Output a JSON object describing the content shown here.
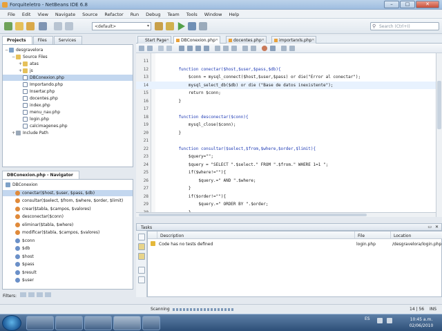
{
  "window": {
    "title": "Forquiteletro - NetBeans IDE 6.8"
  },
  "menus": [
    "File",
    "Edit",
    "View",
    "Navigate",
    "Source",
    "Refactor",
    "Run",
    "Debug",
    "Team",
    "Tools",
    "Window",
    "Help"
  ],
  "toolbar": {
    "config_value": "<default>",
    "search_placeholder": "Search (Ctrl+I)"
  },
  "project_panel": {
    "tabs": [
      "Projects",
      "Files",
      "Services"
    ],
    "items": [
      {
        "label": "desgravelora",
        "depth": 0,
        "icon": "project-icon",
        "exp": "−"
      },
      {
        "label": "Source Files",
        "depth": 1,
        "icon": "folder-icon",
        "exp": "−"
      },
      {
        "label": "atas",
        "depth": 2,
        "icon": "folder-icon",
        "exp": "+"
      },
      {
        "label": "js",
        "depth": 2,
        "icon": "folder-icon",
        "exp": "+"
      },
      {
        "label": "DBConexion.php",
        "depth": 2,
        "icon": "php-file-icon",
        "exp": "",
        "selected": true
      },
      {
        "label": "Importando.php",
        "depth": 2,
        "icon": "php-file-icon",
        "exp": ""
      },
      {
        "label": "Insertar.php",
        "depth": 2,
        "icon": "php-file-icon",
        "exp": ""
      },
      {
        "label": "docentes.php",
        "depth": 2,
        "icon": "php-file-icon",
        "exp": ""
      },
      {
        "label": "index.php",
        "depth": 2,
        "icon": "php-file-icon",
        "exp": ""
      },
      {
        "label": "menu_nav.php",
        "depth": 2,
        "icon": "php-file-icon",
        "exp": ""
      },
      {
        "label": "login.php",
        "depth": 2,
        "icon": "php-file-icon",
        "exp": ""
      },
      {
        "label": "calcimagenes.php",
        "depth": 2,
        "icon": "php-file-icon",
        "exp": ""
      },
      {
        "label": "Include Path",
        "depth": 1,
        "icon": "library-icon",
        "exp": "+"
      }
    ]
  },
  "navigator_panel": {
    "title": "DBConexion.php - Navigator",
    "items": [
      {
        "label": "DBConexion",
        "kind": "class"
      },
      {
        "label": "conectar($host, $user, $pass, $db)",
        "kind": "method",
        "selected": true
      },
      {
        "label": "consultar($select, $from, $where, $order, $limit)",
        "kind": "method"
      },
      {
        "label": "crear($tabla, $campos, $valores)",
        "kind": "method"
      },
      {
        "label": "desconectar($conn)",
        "kind": "method"
      },
      {
        "label": "eliminar($tabla, $where)",
        "kind": "method"
      },
      {
        "label": "modificar($tabla, $campos, $valores)",
        "kind": "method"
      },
      {
        "label": "$conn",
        "kind": "var"
      },
      {
        "label": "$db",
        "kind": "var"
      },
      {
        "label": "$host",
        "kind": "var"
      },
      {
        "label": "$pass",
        "kind": "var"
      },
      {
        "label": "$result",
        "kind": "var"
      },
      {
        "label": "$user",
        "kind": "var"
      }
    ],
    "filters_label": "Filters:"
  },
  "editor": {
    "tabs": [
      "Start Page",
      "DBConexion.php",
      "docentes.php",
      "importarxls.php"
    ],
    "active_tab": 1,
    "lines": [
      {
        "n": "11",
        "t": ""
      },
      {
        "n": "12",
        "t": "    function conectar($host,$user,$pass,$db){"
      },
      {
        "n": "13",
        "t": "        $conn = mysql_connect($host,$user,$pass) or die(\"Error al conectar\");"
      },
      {
        "n": "14",
        "t": "        mysql_select_db($db) or die (\"Base de datos inexistente\");",
        "hl": true
      },
      {
        "n": "15",
        "t": "        return $conn;"
      },
      {
        "n": "16",
        "t": "    }"
      },
      {
        "n": "17",
        "t": ""
      },
      {
        "n": "18",
        "t": "    function desconectar($conn){"
      },
      {
        "n": "19",
        "t": "        mysql_close($conn);"
      },
      {
        "n": "20",
        "t": "    }"
      },
      {
        "n": "21",
        "t": ""
      },
      {
        "n": "22",
        "t": "    function consultar($select,$from,$where,$order,$limit){"
      },
      {
        "n": "23",
        "t": "        $query=\"\";"
      },
      {
        "n": "24",
        "t": "        $query = \"SELECT \".$select.\" FROM \".$from.\" WHERE 1=1 \";"
      },
      {
        "n": "25",
        "t": "        if($where!=\"\"){"
      },
      {
        "n": "26",
        "t": "            $query.=\" AND \".$where;"
      },
      {
        "n": "27",
        "t": "        }"
      },
      {
        "n": "28",
        "t": "        if($order!=\"\"){"
      },
      {
        "n": "29",
        "t": "            $query.=\" ORDER BY \".$order;"
      },
      {
        "n": "30",
        "t": "        }"
      }
    ]
  },
  "tasks": {
    "title": "Tasks",
    "columns": [
      "Description",
      "File",
      "Location"
    ],
    "rows": [
      {
        "description": "Code has no tests defined",
        "file": "login.php",
        "location": "/desgravelora/login.php"
      }
    ]
  },
  "status": {
    "left": "Scanning",
    "position": "14 | 56",
    "mode": "INS"
  },
  "clock": {
    "time": "10:45 a.m.",
    "date": "02/06/2010"
  },
  "tray": {
    "lang": "ES"
  }
}
